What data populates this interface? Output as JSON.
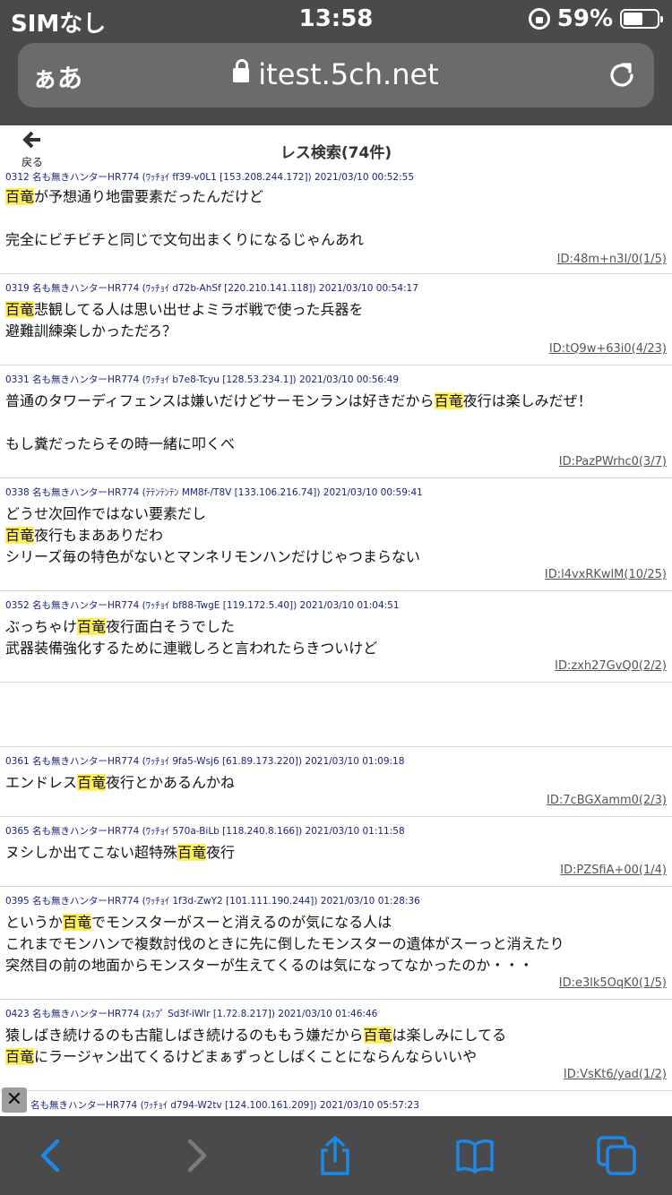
{
  "status": {
    "carrier": "SIMなし",
    "time": "13:58",
    "battery": "59%",
    "battery_level": 0.59
  },
  "browser": {
    "text_size_label": "ぁあ",
    "url": "itest.5ch.net"
  },
  "page": {
    "back_label": "戻る",
    "title": "レス検索(74件)"
  },
  "highlight_color": "#ffee58",
  "posts": [
    {
      "meta": "0312 名も無きハンターHR774 (ﾜｯﾁｮｲ ff39-v0L1 [153.208.244.172]) 2021/03/10 00:52:55",
      "lines": [
        {
          "pre": "",
          "hl": "百竜",
          "post": "が予想通り地雷要素だったんだけど"
        },
        {
          "pre": "",
          "hl": "",
          "post": ""
        },
        {
          "pre": "完全にビチビチと同じで文句出まくりになるじゃんあれ",
          "hl": "",
          "post": ""
        }
      ],
      "id": "ID:48m+n3I/0(1/5)"
    },
    {
      "meta": "0319 名も無きハンターHR774 (ﾜｯﾁｮｲ d72b-AhSf [220.210.141.118]) 2021/03/10 00:54:17",
      "lines": [
        {
          "pre": "",
          "hl": "百竜",
          "post": "悲観してる人は思い出せよミラボ戦で使った兵器を"
        },
        {
          "pre": "避難訓練楽しかっただろ？",
          "hl": "",
          "post": ""
        }
      ],
      "id": "ID:tQ9w+63i0(4/23)"
    },
    {
      "meta": "0331 名も無きハンターHR774 (ﾜｯﾁｮｲ b7e8-Tcyu [128.53.234.1]) 2021/03/10 00:56:49",
      "lines": [
        {
          "pre": "普通のタワーディフェンスは嫌いだけどサーモンランは好きだから",
          "hl": "百竜",
          "post": "夜行は楽しみだぜ！"
        },
        {
          "pre": "",
          "hl": "",
          "post": ""
        },
        {
          "pre": "もし糞だったらその時一緒に叩くべ",
          "hl": "",
          "post": ""
        }
      ],
      "id": "ID:PazPWrhc0(3/7)"
    },
    {
      "meta": "0338 名も無きハンターHR774 (ﾃﾃﾝﾃﾝﾃﾝ MM8f-/T8V [133.106.216.74]) 2021/03/10 00:59:41",
      "lines": [
        {
          "pre": "どうせ次回作ではない要素だし",
          "hl": "",
          "post": ""
        },
        {
          "pre": "",
          "hl": "百竜",
          "post": "夜行もまあありだわ"
        },
        {
          "pre": "シリーズ毎の特色がないとマンネリモンハンだけじゃつまらない",
          "hl": "",
          "post": ""
        }
      ],
      "id": "ID:l4vxRKwlM(10/25)"
    },
    {
      "meta": "0352 名も無きハンターHR774 (ﾜｯﾁｮｲ bf88-TwgE [119.172.5.40]) 2021/03/10 01:04:51",
      "lines": [
        {
          "pre": "ぶっちゃけ",
          "hl": "百竜",
          "post": "夜行面白そうでした"
        },
        {
          "pre": "武器装備強化するために連戦しろと言われたらきついけど",
          "hl": "",
          "post": ""
        }
      ],
      "id": "ID:zxh27GvQ0(2/2)"
    },
    {
      "meta": "0361 名も無きハンターHR774 (ﾜｯﾁｮｲ 9fa5-Wsj6 [61.89.173.220]) 2021/03/10 01:09:18",
      "lines": [
        {
          "pre": "エンドレス",
          "hl": "百竜",
          "post": "夜行とかあるんかね"
        }
      ],
      "id": "ID:7cBGXamm0(2/3)"
    },
    {
      "meta": "0365 名も無きハンターHR774 (ﾜｯﾁｮｲ 570a-BiLb [118.240.8.166]) 2021/03/10 01:11:58",
      "lines": [
        {
          "pre": "ヌシしか出てこない超特殊",
          "hl": "百竜",
          "post": "夜行"
        }
      ],
      "id": "ID:PZSfiA+00(1/4)"
    },
    {
      "meta": "0395 名も無きハンターHR774 (ﾜｯﾁｮｲ 1f3d-ZwY2 [101.111.190.244]) 2021/03/10 01:28:36",
      "lines": [
        {
          "pre": "というか",
          "hl": "百竜",
          "post": "でモンスターがスーと消えるのが気になる人は"
        },
        {
          "pre": "これまでモンハンで複数討伐のときに先に倒したモンスターの遺体がスーっと消えたり",
          "hl": "",
          "post": ""
        },
        {
          "pre": "突然目の前の地面からモンスターが生えてくるのは気になってなかったのか・・・",
          "hl": "",
          "post": ""
        }
      ],
      "id": "ID:e3lk5OqK0(1/5)"
    },
    {
      "meta": "0423 名も無きハンターHR774 (ｽｯﾌﾟ Sd3f-iWlr [1.72.8.217]) 2021/03/10 01:46:46",
      "lines": [
        {
          "pre": "猿しばき続けるのも古龍しばき続けるのももう嫌だから",
          "hl": "百竜",
          "post": "は楽しみにしてる"
        },
        {
          "pre": "",
          "hl": "百竜",
          "post": "にラージャン出てくるけどまぁずっとしばくことにならんならいいや"
        }
      ],
      "id": "ID:VsKt6/yad(1/2)"
    }
  ],
  "partial_post_meta": "名も無きハンターHR774 (ﾜｯﾁｮｲ d794-W2tv [124.100.161.209]) 2021/03/10 05:57:23",
  "close_label": "✕",
  "toolbar": {
    "icons": [
      "back-icon",
      "forward-icon",
      "share-icon",
      "bookmarks-icon",
      "tabs-icon"
    ],
    "accent": "#1e88e5"
  }
}
